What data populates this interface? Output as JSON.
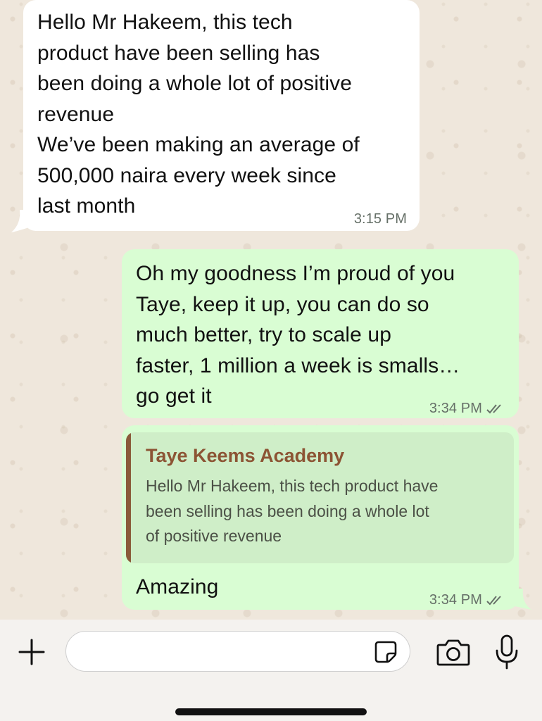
{
  "messages": [
    {
      "direction": "incoming",
      "text": "Hello Mr Hakeem, this tech\nproduct have been selling has\nbeen doing a whole lot of positive\nrevenue\nWe’ve been making an average of\n500,000 naira every week since\nlast month",
      "time": "3:15 PM"
    },
    {
      "direction": "outgoing",
      "text": "Oh my goodness I’m proud of you\nTaye, keep it up, you can do so\nmuch better, try to scale up\nfaster, 1 million a week is smalls…\ngo get it",
      "time": "3:34 PM",
      "status_icon": "double-check-icon"
    },
    {
      "direction": "outgoing",
      "reply_to": {
        "author": "Taye Keems Academy",
        "text": "Hello Mr Hakeem, this tech product have\nbeen selling has been doing a whole lot\nof positive revenue"
      },
      "text": "Amazing",
      "time": "3:34 PM",
      "status_icon": "double-check-icon"
    }
  ],
  "composer": {
    "placeholder": "",
    "icons": [
      "plus-icon",
      "sticker-icon",
      "camera-icon",
      "microphone-icon"
    ]
  },
  "colors": {
    "background": "#efe7dc",
    "incoming_bubble": "#ffffff",
    "outgoing_bubble": "#d9fdd3",
    "quote_author": "#8c5434",
    "quote_bar": "#8a5a3a"
  }
}
